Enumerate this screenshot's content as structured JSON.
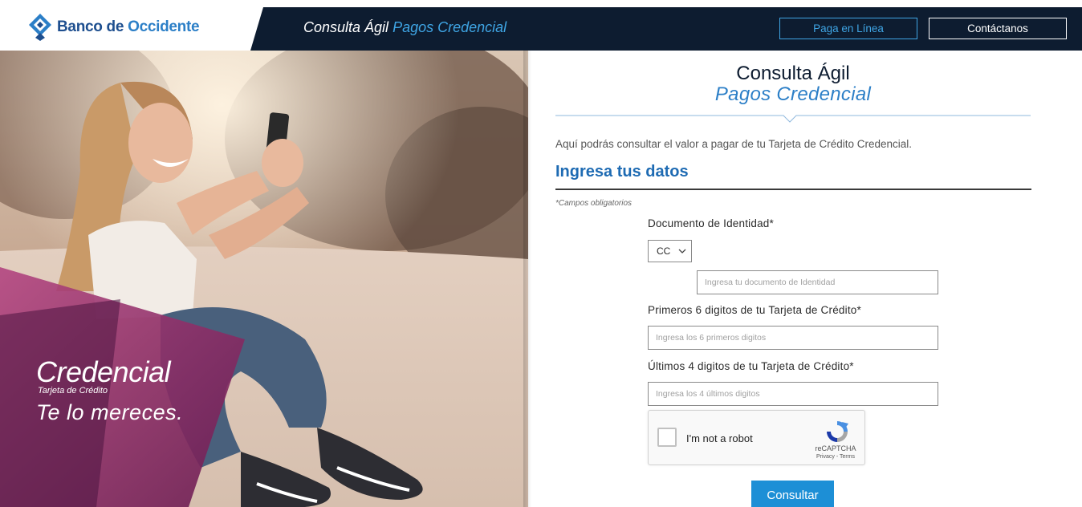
{
  "header": {
    "logo_text_primary": "Banco de ",
    "logo_text_accent": "Occidente",
    "title_main": "Consulta Ágil ",
    "title_sub": "Pagos Credencial",
    "btn_paga": "Paga en Línea",
    "btn_contact": "Contáctanos"
  },
  "hero": {
    "brand_name": "Credencial",
    "brand_tag": "Tarjeta de Crédito",
    "slogan": "Te lo mereces."
  },
  "form": {
    "title_main": "Consulta Ágil",
    "title_sub": "Pagos Credencial",
    "intro": "Aquí podrás consultar el valor a pagar de tu Tarjeta de Crédito Credencial.",
    "section_title": "Ingresa tus datos",
    "required_note": "*Campos obligatorios",
    "doc_label": "Documento de Identidad*",
    "doc_type_value": "CC",
    "doc_placeholder": "Ingresa tu documento de Identidad",
    "first6_label": "Primeros 6 digitos de tu Tarjeta de Crédito*",
    "first6_placeholder": "Ingresa los 6 primeros digitos",
    "last4_label": "Últimos 4 digitos de tu Tarjeta de Crédito*",
    "last4_placeholder": "Ingresa los 4 últimos digitos",
    "captcha_text": "I'm not a robot",
    "captcha_brand": "reCAPTCHA",
    "captcha_links": "Privacy - Terms",
    "submit_label": "Consultar"
  },
  "colors": {
    "navy": "#0d1c30",
    "accent_blue": "#2c7fc7",
    "light_blue": "#3fa5e4",
    "button_blue": "#1d8fd6",
    "magenta": "#8e2a6d"
  }
}
